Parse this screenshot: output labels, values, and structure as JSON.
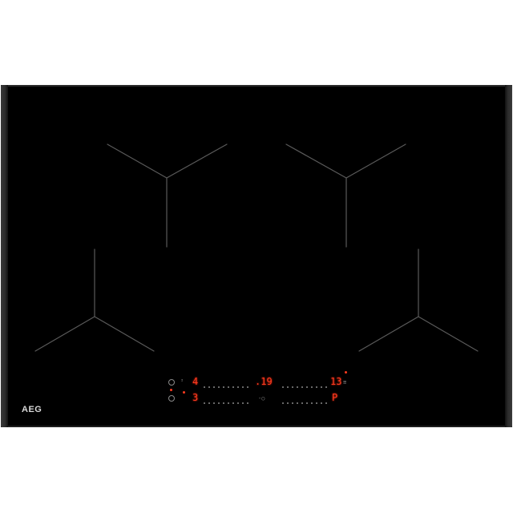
{
  "product": {
    "brand": "AEG",
    "colors": {
      "glass": "#000000",
      "frame": "#2b2b2b",
      "zone_marking": "#5a5a5a",
      "display_red": "#ff3b1f",
      "control_grey": "#8a8a8a"
    }
  },
  "controls": {
    "front_left_power": "4",
    "front_center_timer": ".19",
    "front_right_power": "13",
    "rear_left_power": "3",
    "rear_right_power": "P"
  },
  "icons": {
    "power": "power-icon",
    "lock": "lock-icon",
    "minus": "minus-icon",
    "plus": "plus-icon",
    "cooking_zone": "cooking-zone-marking-icon"
  }
}
